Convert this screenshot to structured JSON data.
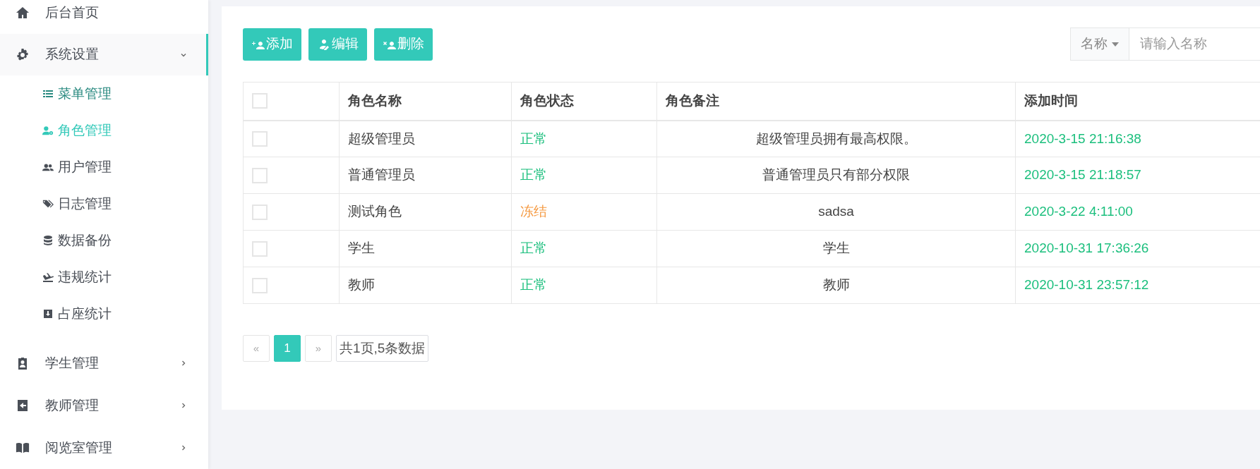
{
  "sidebar": {
    "items": [
      {
        "label": "后台首页",
        "kind": "link",
        "expanded": false
      },
      {
        "label": "系统设置",
        "kind": "menu",
        "expanded": true,
        "children": [
          {
            "label": "菜单管理",
            "selected": false,
            "hovered": true
          },
          {
            "label": "角色管理",
            "selected": true,
            "hovered": false
          },
          {
            "label": "用户管理",
            "selected": false,
            "hovered": false
          },
          {
            "label": "日志管理",
            "selected": false,
            "hovered": false
          },
          {
            "label": "数据备份",
            "selected": false,
            "hovered": false
          },
          {
            "label": "违规统计",
            "selected": false,
            "hovered": false
          },
          {
            "label": "占座统计",
            "selected": false,
            "hovered": false
          }
        ]
      },
      {
        "label": "学生管理",
        "kind": "menu",
        "expanded": false
      },
      {
        "label": "教师管理",
        "kind": "menu",
        "expanded": false
      },
      {
        "label": "阅览室管理",
        "kind": "menu",
        "expanded": false
      }
    ]
  },
  "toolbar": {
    "buttons": [
      "添加",
      "编辑",
      "删除"
    ]
  },
  "search": {
    "field_label": "名称",
    "placeholder": "请输入名称"
  },
  "table": {
    "header_checked": false,
    "columns": [
      "角色名称",
      "角色状态",
      "角色备注",
      "添加时间"
    ],
    "rows": [
      {
        "checked": false,
        "name": "超级管理员",
        "status": "正常",
        "color": "#1bbf7d",
        "remark": "超级管理员拥有最高权限。",
        "time": "2020-3-15 21:16:38"
      },
      {
        "checked": false,
        "name": "普通管理员",
        "status": "正常",
        "color": "#1bbf7d",
        "remark": "普通管理员只有部分权限",
        "time": "2020-3-15 21:18:57"
      },
      {
        "checked": false,
        "name": "测试角色",
        "status": "冻结",
        "color": "#f59a42",
        "remark": "sadsa",
        "time": "2020-3-22 4:11:00"
      },
      {
        "checked": false,
        "name": "学生",
        "status": "正常",
        "color": "#1bbf7d",
        "remark": "学生",
        "time": "2020-10-31 17:36:26"
      },
      {
        "checked": false,
        "name": "教师",
        "status": "正常",
        "color": "#1bbf7d",
        "remark": "教师",
        "time": "2020-10-31 23:57:12"
      }
    ]
  },
  "pagination": {
    "prev": "«",
    "pages": [
      {
        "label": "1",
        "selected": true
      }
    ],
    "next": "»",
    "info": "共1页,5条数据"
  }
}
